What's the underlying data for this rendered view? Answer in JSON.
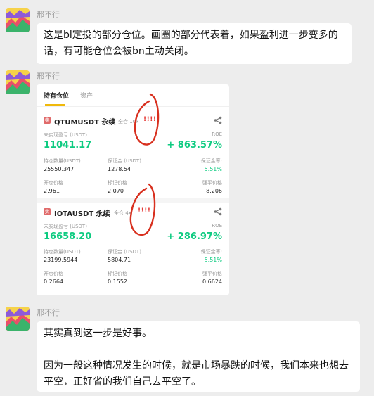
{
  "messages": [
    {
      "sender": "邢不行",
      "text": "这是bl定投的部分仓位。画圈的部分代表着，如果盈利进一步变多的话，有可能仓位会被bn主动关闭。"
    },
    {
      "sender": "邢不行",
      "screenshot": {
        "tabs": [
          "持有仓位",
          "资产"
        ],
        "positions": [
          {
            "tag": "卖",
            "symbol": "QTUMUSDT 永续",
            "leverage": "全仓 10x",
            "exclaim": "!!!!",
            "pnl_label": "未实现盈亏 (USDT)",
            "pnl": "11041.17",
            "roe_label": "ROE",
            "roe": "+ 863.57%",
            "size_label": "持仓数量(USDT)",
            "size": "25550.347",
            "margin_label": "保证金 (USDT)",
            "margin": "1278.54",
            "margin_ratio_label": "保证金率:",
            "margin_ratio": "5.51%",
            "entry_label": "开仓价格",
            "entry": "2.961",
            "mark_label": "标记价格",
            "mark": "2.070",
            "liq_label": "强平价格",
            "liq": "8.206"
          },
          {
            "tag": "卖",
            "symbol": "IOTAUSDT 永续",
            "leverage": "全仓 4x",
            "exclaim": "!!!!",
            "pnl_label": "未实现盈亏 (USDT)",
            "pnl": "16658.20",
            "roe_label": "ROE",
            "roe": "+ 286.97%",
            "size_label": "持仓数量(USDT)",
            "size": "23199.5944",
            "margin_label": "保证金 (USDT)",
            "margin": "5804.71",
            "margin_ratio_label": "保证金率:",
            "margin_ratio": "5.51%",
            "entry_label": "开仓价格",
            "entry": "0.2664",
            "mark_label": "标记价格",
            "mark": "0.1552",
            "liq_label": "强平价格",
            "liq": "0.6624"
          }
        ]
      }
    },
    {
      "sender": "邢不行",
      "paragraphs": [
        "其实真到这一步是好事。",
        "因为一般这种情况发生的时候，就是市场暴跌的时候，我们本来也想去平空，正好省的我们自己去平空了。"
      ]
    }
  ],
  "colors": {
    "background": "#ededed",
    "bubble": "#ffffff",
    "profit_green": "#0ecb81",
    "sell_red": "#e06a6a",
    "annotation_red": "#d8301f",
    "tab_underline": "#f0b90b"
  },
  "icons": [
    "wechat-avatar-icon",
    "share-icon"
  ]
}
